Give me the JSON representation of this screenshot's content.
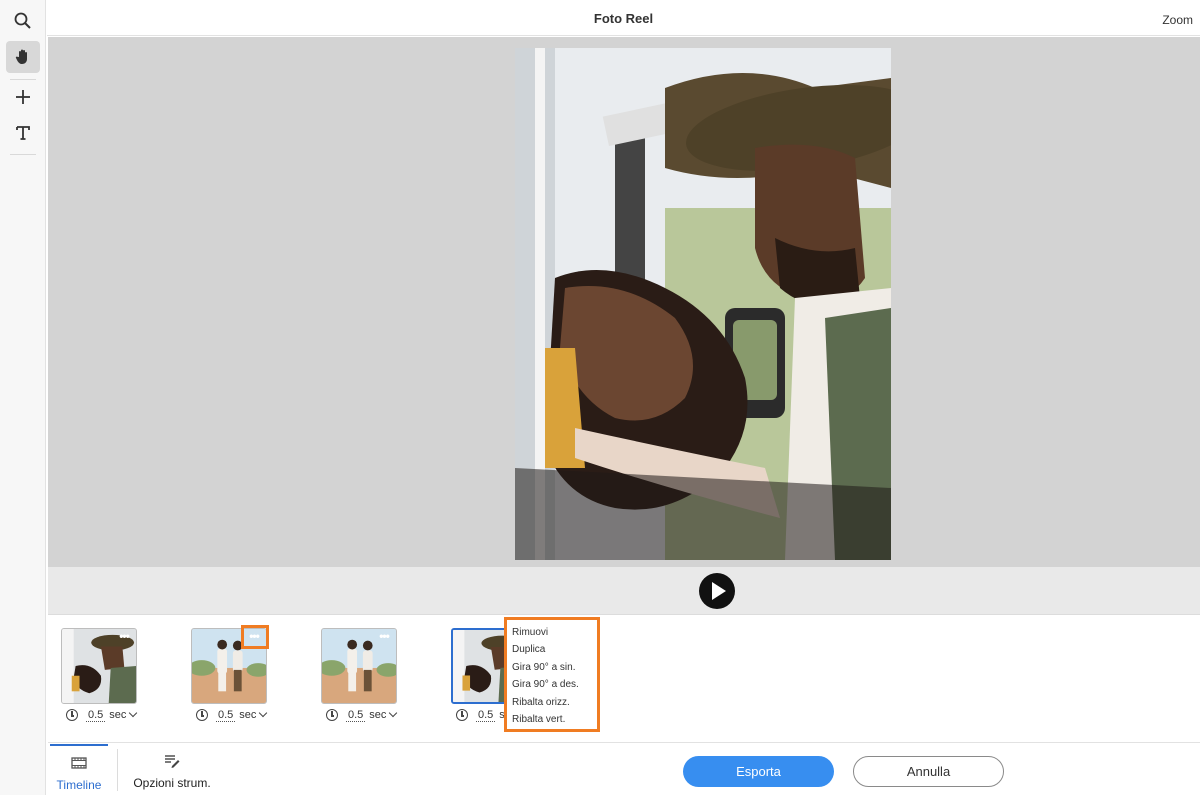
{
  "header": {
    "title": "Foto Reel",
    "zoom_label": "Zoom"
  },
  "toolbar": {
    "tools": [
      {
        "name": "search-icon",
        "active": false
      },
      {
        "name": "hand-icon",
        "active": true
      },
      {
        "name": "crosshair-plus-icon",
        "active": false
      },
      {
        "name": "text-tool-icon",
        "active": false
      }
    ]
  },
  "player": {
    "play_icon": "play-icon"
  },
  "timeline": {
    "clips": [
      {
        "duration": "0.5",
        "unit": "sec",
        "thumb": "couple-hat"
      },
      {
        "duration": "0.5",
        "unit": "sec",
        "thumb": "couple-walking"
      },
      {
        "duration": "0.5",
        "unit": "sec",
        "thumb": "couple-walking"
      },
      {
        "duration": "0.5",
        "unit": "sec",
        "thumb": "couple-hat"
      }
    ],
    "context_menu": [
      "Rimuovi",
      "Duplica",
      "Gira 90° a sin.",
      "Gira 90° a des.",
      "Ribalta orizz.",
      "Ribalta vert."
    ]
  },
  "bottom": {
    "tab_timeline": "Timeline",
    "tab_options": "Opzioni strum.",
    "export_label": "Esporta",
    "cancel_label": "Annulla"
  },
  "colors": {
    "accent": "#378ef0",
    "highlight": "#f07c22",
    "selected_border": "#2d6ecf"
  }
}
